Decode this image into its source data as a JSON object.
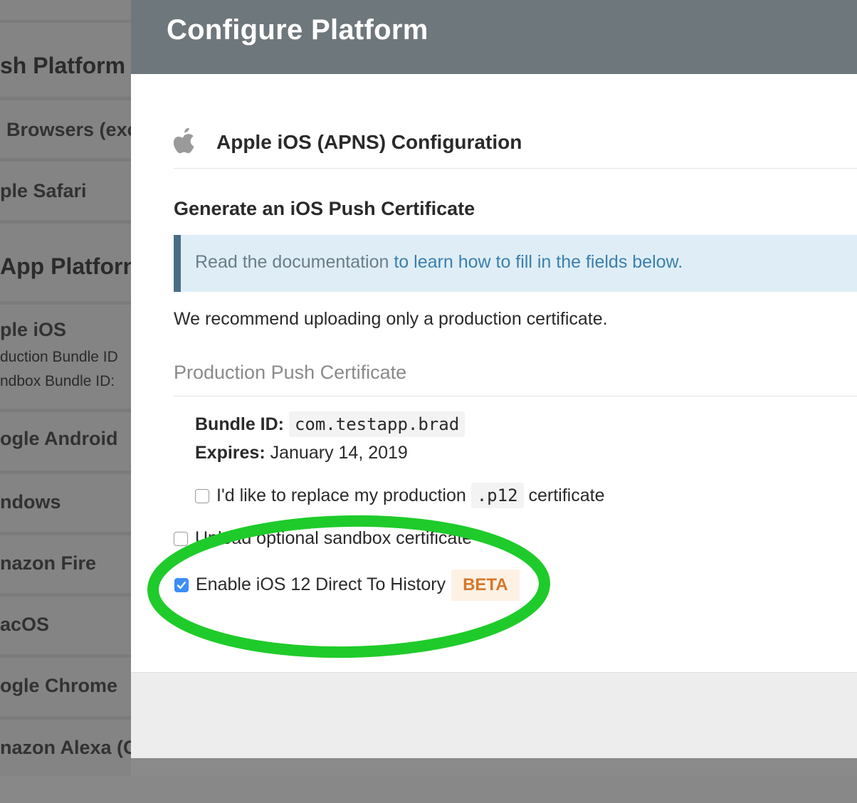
{
  "background": {
    "rows": [
      {
        "kind": "heading",
        "label": "sh Platform"
      },
      {
        "kind": "item",
        "label": "Browsers (exc"
      },
      {
        "kind": "item",
        "label": "ple Safari"
      },
      {
        "kind": "heading",
        "label": "App Platforn"
      },
      {
        "kind": "item",
        "label": "ple iOS",
        "sub": [
          "duction Bundle ID",
          "ndbox Bundle ID:"
        ]
      },
      {
        "kind": "item",
        "label": "ogle Android"
      },
      {
        "kind": "item",
        "label": "ndows"
      },
      {
        "kind": "item",
        "label": "nazon Fire"
      },
      {
        "kind": "item",
        "label": "acOS"
      },
      {
        "kind": "item",
        "label": "ogle Chrome"
      },
      {
        "kind": "item",
        "label": "nazon Alexa (C"
      }
    ],
    "obscured_text": "...g..."
  },
  "modal": {
    "title": "Configure Platform",
    "platform_icon": "apple-icon",
    "platform_title": "Apple iOS (APNS) Configuration",
    "section_title": "Generate an iOS Push Certificate",
    "info": {
      "prefix": "Read the documentation ",
      "link": "to learn how to fill in the fields below."
    },
    "recommend_text": "We recommend uploading only a production certificate.",
    "production_title": "Production Push Certificate",
    "bundle_id_label": "Bundle ID:",
    "bundle_id_value": "com.testapp.brad",
    "expires_label": "Expires:",
    "expires_value": "January 14, 2019",
    "replace_checkbox": {
      "checked": false,
      "label_before": "I'd like to replace my production",
      "code": ".p12",
      "label_after": "certificate"
    },
    "sandbox_checkbox": {
      "checked": false,
      "label": "Upload optional sandbox certificate"
    },
    "history_checkbox": {
      "checked": true,
      "label": "Enable iOS 12 Direct To History",
      "badge": "BETA"
    }
  },
  "colors": {
    "header_bg": "#6e777c",
    "info_bg": "#dfeef6",
    "info_border": "#4a6d85",
    "link": "#3b7fae",
    "checkbox_checked": "#3d8ef5",
    "badge_text": "#d5782d",
    "badge_bg": "#fdf1e4",
    "highlight": "#1ecb2a"
  }
}
